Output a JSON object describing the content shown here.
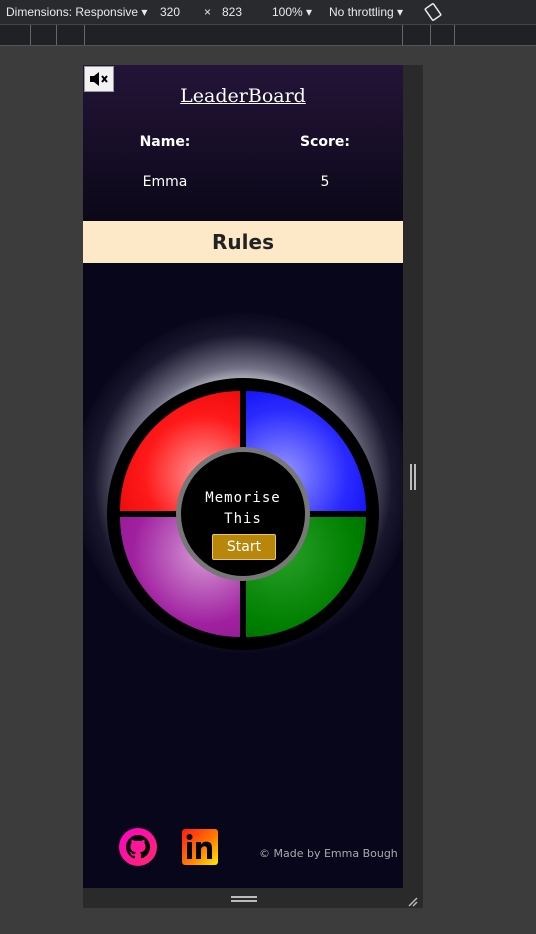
{
  "devtools": {
    "dimensions_label": "Dimensions: Responsive",
    "width_value": "320",
    "times": "×",
    "height_value": "823",
    "zoom": "100%",
    "throttling": "No throttling"
  },
  "leaderboard": {
    "title": "LeaderBoard",
    "name_header": "Name:",
    "score_header": "Score:",
    "entries": [
      {
        "name": "Emma",
        "score": "5"
      }
    ]
  },
  "rules": {
    "label": "Rules"
  },
  "game": {
    "center_line1": "Memorise",
    "center_line2": "This",
    "start_label": "Start",
    "colors": {
      "red": "#ff1a1a",
      "blue": "#2a2aff",
      "purple": "#a020a0",
      "green": "#008000",
      "start": "#b8860b"
    }
  },
  "footer": {
    "credit": "© Made by Emma Bough",
    "icons": [
      "github-icon",
      "linkedin-icon"
    ]
  }
}
